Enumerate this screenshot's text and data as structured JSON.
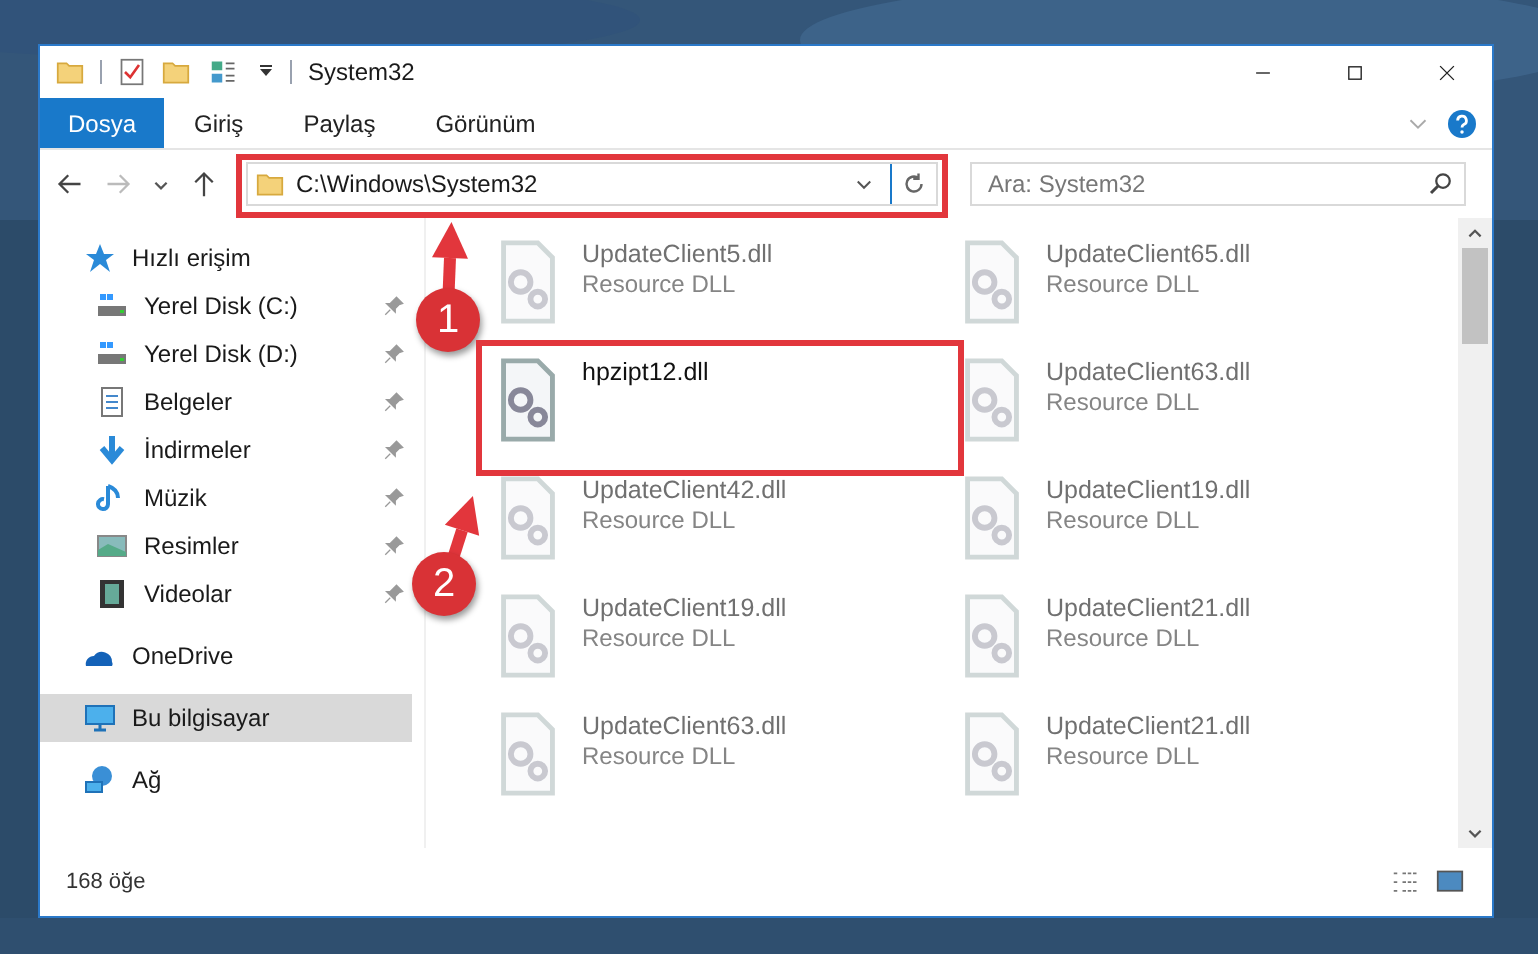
{
  "window": {
    "title": "System32"
  },
  "ribbon_tabs": [
    {
      "label": "Dosya",
      "selected": true
    },
    {
      "label": "Giriş",
      "selected": false
    },
    {
      "label": "Paylaş",
      "selected": false
    },
    {
      "label": "Görünüm",
      "selected": false
    }
  ],
  "address_bar": {
    "path": "C:\\Windows\\System32"
  },
  "search": {
    "placeholder": "Ara: System32"
  },
  "sidebar": {
    "items": [
      {
        "label": "Hızlı erişim",
        "kind": "star",
        "selected": false,
        "children": [
          {
            "label": "Yerel Disk (C:)",
            "kind": "drive",
            "pinned": true,
            "selected": false
          },
          {
            "label": "Yerel Disk (D:)",
            "kind": "drive",
            "pinned": true,
            "selected": false
          },
          {
            "label": "Belgeler",
            "kind": "docs",
            "pinned": true,
            "selected": false
          },
          {
            "label": "İndirmeler",
            "kind": "download",
            "pinned": true,
            "selected": false
          },
          {
            "label": "Müzik",
            "kind": "music",
            "pinned": true,
            "selected": false
          },
          {
            "label": "Resimler",
            "kind": "pictures",
            "pinned": true,
            "selected": false
          },
          {
            "label": "Videolar",
            "kind": "video",
            "pinned": true,
            "selected": false
          }
        ]
      },
      {
        "label": "OneDrive",
        "kind": "cloud",
        "selected": false
      },
      {
        "label": "Bu bilgisayar",
        "kind": "pc",
        "selected": true
      },
      {
        "label": "Ağ",
        "kind": "network",
        "selected": false
      }
    ]
  },
  "files": [
    {
      "name": "UpdateClient5.dll",
      "type": "Resource DLL",
      "blurred": true
    },
    {
      "name": "UpdateClient65.dll",
      "type": "Resource DLL",
      "blurred": true
    },
    {
      "name": "hpzipt12.dll",
      "blurred": false
    },
    {
      "name": "UpdateClient63.dll",
      "type": "Resource DLL",
      "blurred": true
    },
    {
      "name": "UpdateClient42.dll",
      "type": "Resource DLL",
      "blurred": true
    },
    {
      "name": "UpdateClient19.dll",
      "type": "Resource DLL",
      "blurred": true
    },
    {
      "name": "UpdateClient19.dll",
      "type": "Resource DLL",
      "blurred": true
    },
    {
      "name": "UpdateClient21.dll",
      "type": "Resource DLL",
      "blurred": true
    },
    {
      "name": "UpdateClient63.dll",
      "type": "Resource DLL",
      "blurred": true
    },
    {
      "name": "UpdateClient21.dll",
      "type": "Resource DLL",
      "blurred": true
    }
  ],
  "status_bar": {
    "item_count": "168 öğe"
  },
  "annotations": [
    {
      "number": "1"
    },
    {
      "number": "2"
    }
  ]
}
